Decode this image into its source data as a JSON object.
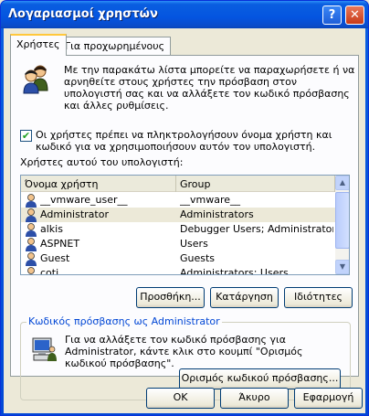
{
  "window": {
    "title": "Λογαριασμοί χρηστών",
    "help_label": "?",
    "close_label": "✕"
  },
  "tabs": [
    {
      "label": "Χρήστες"
    },
    {
      "label": "Για προχωρημένους"
    }
  ],
  "intro": {
    "text": "Με την παρακάτω λίστα μπορείτε να παραχωρήσετε ή να αρνηθείτε στους χρήστες την πρόσβαση στον υπολογιστή σας και να αλλάξετε τον κωδικό πρόσβασης και άλλες ρυθμίσεις."
  },
  "require_login": {
    "checked": true,
    "check_glyph": "✔",
    "label": "Οι χρήστες πρέπει να πληκτρολογήσουν όνομα χρήστη και κωδικό για να χρησιμοποιήσουν αυτόν τον υπολογιστή."
  },
  "users_list": {
    "label": "Χρήστες αυτού του υπολογιστή:",
    "columns": [
      "Όνομα χρήστη",
      "Group"
    ],
    "rows": [
      {
        "name": "__vmware_user__",
        "group": "__vmware__",
        "selected": false
      },
      {
        "name": "Administrator",
        "group": "Administrators",
        "selected": true
      },
      {
        "name": "alkis",
        "group": "Debugger Users; Administrators",
        "selected": false
      },
      {
        "name": "ASPNET",
        "group": "Users",
        "selected": false
      },
      {
        "name": "Guest",
        "group": "Guests",
        "selected": false
      },
      {
        "name": "coti",
        "group": "Administrators; Users",
        "selected": false
      }
    ]
  },
  "list_buttons": {
    "add": "Προσθήκη...",
    "remove": "Κατάργηση",
    "properties": "Ιδιότητες"
  },
  "password_group": {
    "title": "Κωδικός πρόσβασης ως Administrator",
    "text": "Για να αλλάξετε τον κωδικό πρόσβασης για Administrator, κάντε κλικ στο κουμπί \"Ορισμός κωδικού πρόσβασης\".",
    "button": "Ορισμός κωδικού πρόσβασης..."
  },
  "dialog_buttons": {
    "ok": "OK",
    "cancel": "Άκυρο",
    "apply": "Εφαρμογή"
  },
  "colors": {
    "title_bar": "#0a5ee0",
    "face": "#ece9d8",
    "group_title": "#0046d5",
    "tab_highlight": "#ffc83c"
  }
}
